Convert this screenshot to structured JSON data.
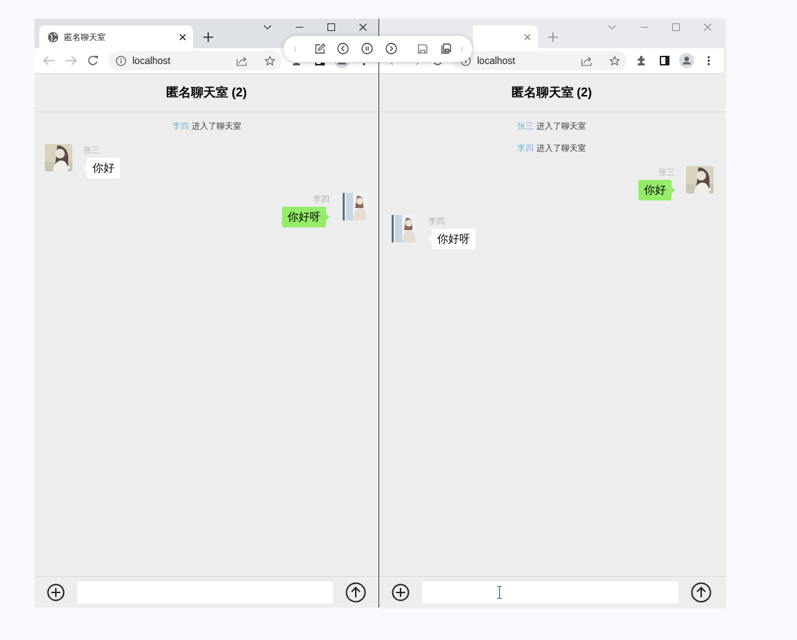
{
  "windows": [
    {
      "active": true,
      "tab": {
        "title": "匿名聊天室"
      },
      "address": "localhost",
      "chat": {
        "title": "匿名聊天室 (2)",
        "messages": [
          {
            "kind": "notice",
            "user": "李四",
            "text": "进入了聊天室"
          },
          {
            "kind": "message",
            "sender": "张三",
            "text": "你好",
            "mine": false
          },
          {
            "kind": "message",
            "sender": "李四",
            "text": "你好呀",
            "mine": true
          }
        ]
      },
      "text_cursor": false
    },
    {
      "active": false,
      "address": "localhost",
      "chat": {
        "title": "匿名聊天室 (2)",
        "messages": [
          {
            "kind": "notice",
            "user": "张三",
            "text": "进入了聊天室"
          },
          {
            "kind": "notice",
            "user": "李四",
            "text": "进入了聊天室"
          },
          {
            "kind": "message",
            "sender": "张三",
            "text": "你好",
            "mine": true
          },
          {
            "kind": "message",
            "sender": "李四",
            "text": "你好呀",
            "mine": false
          }
        ]
      },
      "text_cursor": true
    }
  ]
}
